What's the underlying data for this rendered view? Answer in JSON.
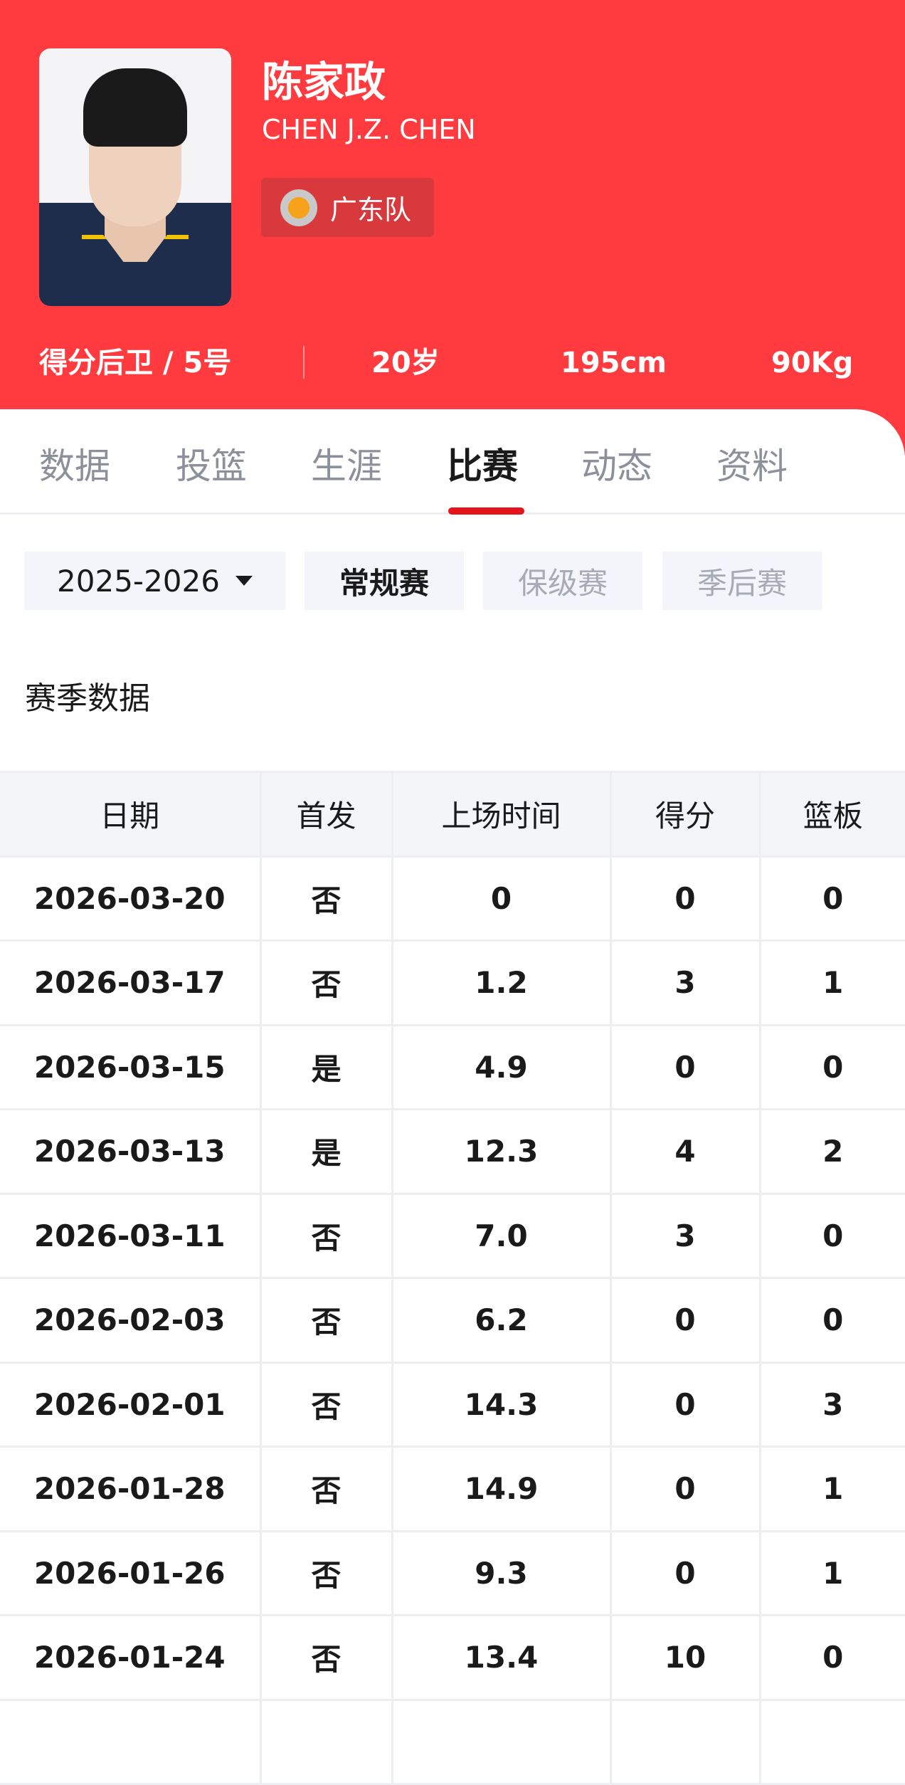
{
  "player": {
    "name": "陈家政",
    "english_name": "CHEN J.Z. CHEN",
    "team": "广东队",
    "position": "得分后卫 / 5号",
    "age": "20岁",
    "height": "195cm",
    "weight": "90Kg"
  },
  "tabs": [
    "数据",
    "投篮",
    "生涯",
    "比赛",
    "动态",
    "资料"
  ],
  "active_tab": "比赛",
  "filters": {
    "season": "2025-2026",
    "types": [
      "常规赛",
      "保级赛",
      "季后赛"
    ],
    "active_type": "常规赛"
  },
  "section_title": "赛季数据",
  "table": {
    "headers": [
      "日期",
      "首发",
      "上场时间",
      "得分",
      "篮板"
    ],
    "rows": [
      [
        "2026-03-20",
        "否",
        "0",
        "0",
        "0"
      ],
      [
        "2026-03-17",
        "否",
        "1.2",
        "3",
        "1"
      ],
      [
        "2026-03-15",
        "是",
        "4.9",
        "0",
        "0"
      ],
      [
        "2026-03-13",
        "是",
        "12.3",
        "4",
        "2"
      ],
      [
        "2026-03-11",
        "否",
        "7.0",
        "3",
        "0"
      ],
      [
        "2026-02-03",
        "否",
        "6.2",
        "0",
        "0"
      ],
      [
        "2026-02-01",
        "否",
        "14.3",
        "0",
        "3"
      ],
      [
        "2026-01-28",
        "否",
        "14.9",
        "0",
        "1"
      ],
      [
        "2026-01-26",
        "否",
        "9.3",
        "0",
        "1"
      ],
      [
        "2026-01-24",
        "否",
        "13.4",
        "10",
        "0"
      ]
    ]
  },
  "colors": {
    "brand": "#ff3b3f",
    "tab_indicator": "#e5131c"
  }
}
